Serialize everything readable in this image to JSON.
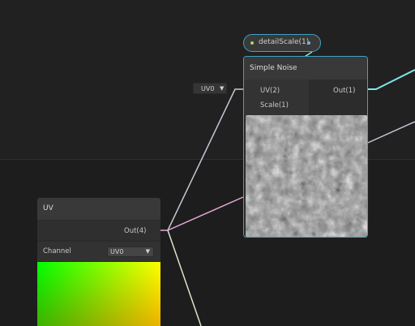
{
  "graph": {
    "property_node": {
      "label": "detailScale(1)"
    },
    "noise_node": {
      "title": "Simple Noise",
      "inputs": [
        "UV(2)",
        "Scale(1)"
      ],
      "outputs": [
        "Out(1)"
      ],
      "inline_uv_value": "UV0"
    },
    "uv_node": {
      "title": "UV",
      "output": "Out(4)",
      "channel_label": "Channel",
      "channel_value": "UV0"
    }
  },
  "colors": {
    "background": "#212121",
    "lower_panel": "#1d1d1d",
    "selection_border": "#3fa2c4",
    "wire_vec2": "#c7c7d6",
    "wire_vec4": "#e5a8d6",
    "wire_float": "#84e4e7"
  },
  "icons": {
    "dropdown": "caret-down-icon",
    "port": "port-dot-icon"
  }
}
